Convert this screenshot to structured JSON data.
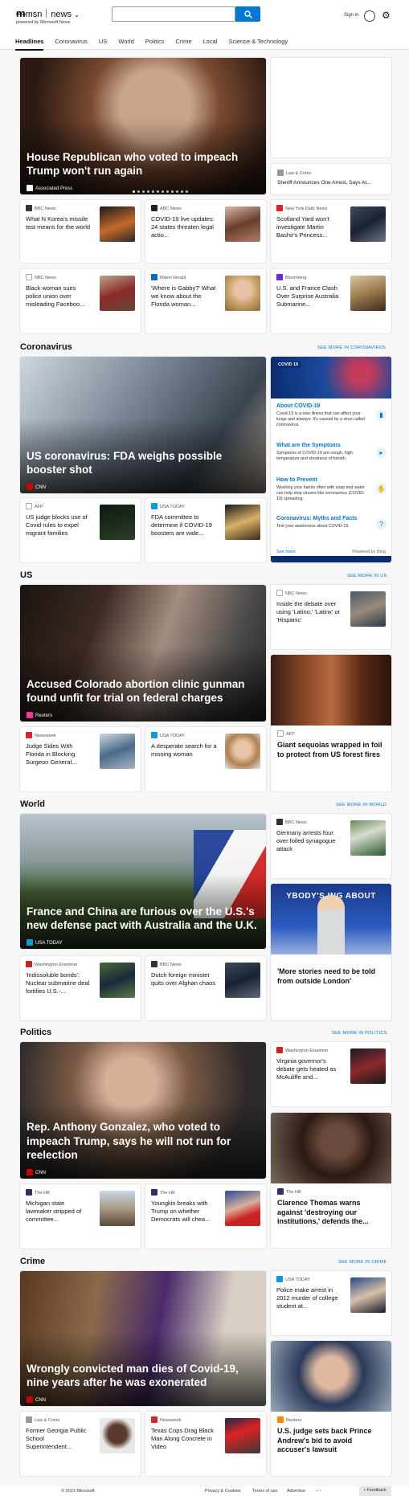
{
  "header": {
    "logo_msn": "msn",
    "logo_news": "news",
    "logo_chev": "⌄",
    "powered": "powered by Microsoft News",
    "search_value": "",
    "sign_in": "Sign in"
  },
  "nav": [
    "Headlines",
    "Coronavirus",
    "US",
    "World",
    "Politics",
    "Crime",
    "Local",
    "Science & Technology"
  ],
  "top": {
    "hero": {
      "title": "House Republican who voted to impeach Trump won't run again",
      "source": "Associated Press"
    },
    "side1": {
      "source": "Law & Crime",
      "title": "Sheriff Announces One Arrest, Says At..."
    },
    "cards": [
      {
        "source": "BBC News",
        "title": "What N Korea's missile test means for the world"
      },
      {
        "source": "ABC News",
        "title": "COVID-19 live updates: 24 states threaten legal actio..."
      },
      {
        "source": "New York Daily News",
        "title": "Scotland Yard won't investigate Martin Bashir's Princess..."
      },
      {
        "source": "NBC News",
        "title": "Black woman sues police union over misleading Faceboo..."
      },
      {
        "source": "Miami Herald",
        "title": "'Where is Gabby?' What we know about the Florida woman..."
      },
      {
        "source": "Bloomberg",
        "title": "U.S. and France Clash Over Surprise Australia Submarine..."
      }
    ]
  },
  "coronavirus": {
    "heading": "Coronavirus",
    "more": "SEE MORE IN CORONAVIRUS",
    "hero": {
      "title": "US coronavirus: FDA weighs possible booster shot",
      "source": "CNN"
    },
    "cards": [
      {
        "source": "AFP",
        "title": "US judge blocks use of Covid rules to expel migrant families"
      },
      {
        "source": "USA TODAY",
        "title": "FDA committee to determine if COVID-19 boosters are wide..."
      }
    ],
    "panel": {
      "tag": "COVID 19",
      "items": [
        {
          "title": "About COVID-19",
          "desc": "Covid-19 is a new illness that can affect your lungs and airways. It's caused by a virus called coronavirus."
        },
        {
          "title": "What are the Symptoms",
          "desc": "Symptoms of COVID-19 are cough, high temperature and shortness of breath."
        },
        {
          "title": "How to Prevent",
          "desc": "Washing your hands often with soap and water can help stop viruses like coronavirus (COVID-19) spreading."
        },
        {
          "title": "Coronavirus: Myths and Facts",
          "desc": "Test your awareness about COVID-19."
        }
      ],
      "see_more": "See more",
      "powered": "Powered by Bing"
    }
  },
  "us": {
    "heading": "US",
    "more": "SEE MORE IN US",
    "hero": {
      "title": "Accused Colorado abortion clinic gunman found unfit for trial on federal charges",
      "source": "Reuters"
    },
    "side1": {
      "source": "NBC News",
      "title": "Inside the debate over using 'Latino,' 'Latinx' or 'Hispanic'"
    },
    "side2": {
      "source": "AFP",
      "title": "Giant sequoias wrapped in foil to protect from US forest fires"
    },
    "cards": [
      {
        "source": "Newsweek",
        "title": "Judge Sides With Florida in Blocking Surgeon General..."
      },
      {
        "source": "USA TODAY",
        "title": "A desperate search for a missing woman"
      }
    ]
  },
  "world": {
    "heading": "World",
    "more": "SEE MORE IN WORLD",
    "hero": {
      "title": "France and China are furious over the U.S.'s new defense pact with Australia and the U.K.",
      "source": "USA TODAY"
    },
    "side1": {
      "source": "BBC News",
      "title": "Germany arrests four over foiled synagogue attack"
    },
    "side2": {
      "title": "'More stories need to be told from outside London'",
      "banner": "YBODY'S  ING ABOUT"
    },
    "cards": [
      {
        "source": "Washington Examiner",
        "title": "'Indissoluble bonds': Nuclear submarine deal fortifies U.S.-..."
      },
      {
        "source": "BBC News",
        "title": "Dutch foreign minister quits over Afghan chaos"
      }
    ]
  },
  "politics": {
    "heading": "Politics",
    "more": "SEE MORE IN POLITICS",
    "hero": {
      "title": "Rep. Anthony Gonzalez, who voted to impeach Trump, says he will not run for reelection",
      "source": "CNN"
    },
    "side1": {
      "source": "Washington Examiner",
      "title": "Virginia governor's debate gets heated as McAuliffe and..."
    },
    "side2": {
      "source": "The Hill",
      "title": "Clarence Thomas warns against 'destroying our institutions,' defends the..."
    },
    "cards": [
      {
        "source": "The Hill",
        "title": "Michigan state lawmaker stripped of committee..."
      },
      {
        "source": "The Hill",
        "title": "Youngkin breaks with Trump on whether Democrats will chea..."
      }
    ]
  },
  "crime": {
    "heading": "Crime",
    "more": "SEE MORE IN CRIME",
    "hero": {
      "title": "Wrongly convicted man dies of Covid-19, nine years after he was exonerated",
      "source": "CNN"
    },
    "side1": {
      "source": "USA TODAY",
      "title": "Police make arrest in 2012 murder of college student at..."
    },
    "side2": {
      "source": "Reuters",
      "title": "U.S. judge sets back Prince Andrew's bid to avoid accuser's lawsuit"
    },
    "cards": [
      {
        "source": "Law & Crime",
        "title": "Former Georgia Public School Superintendent..."
      },
      {
        "source": "Newsweek",
        "title": "Texas Cops Drag Black Man Along Concrete in Video"
      }
    ]
  },
  "footer": {
    "copyright": "© 2021 Microsoft",
    "privacy": "Privacy & Cookies",
    "terms": "Terms of use",
    "advertise": "Advertise",
    "dots": "···",
    "feedback": "Feedback"
  }
}
